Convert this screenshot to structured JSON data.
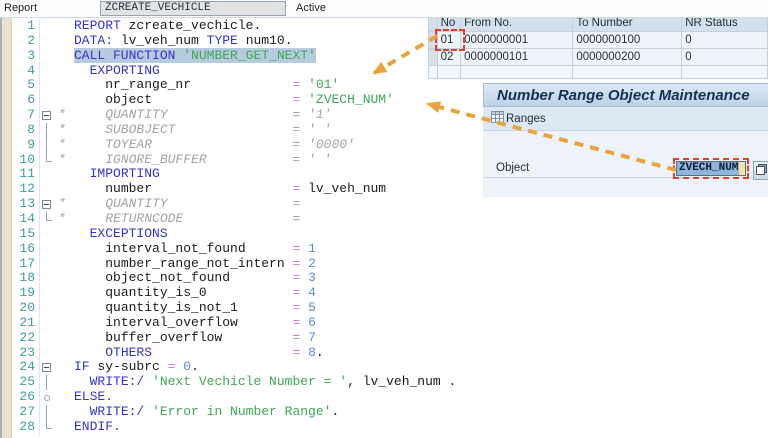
{
  "header": {
    "label": "Report",
    "program_name": "ZCREATE_VECHICLE",
    "status": "Active"
  },
  "editor": {
    "lines": [
      {
        "n": 1,
        "tokens": [
          [
            "kw",
            "REPORT"
          ],
          [
            "pl",
            " "
          ],
          [
            "id",
            "zcreate_vechicle"
          ],
          [
            "pl",
            "."
          ]
        ]
      },
      {
        "n": 2,
        "tokens": [
          [
            "kw",
            "DATA:"
          ],
          [
            "pl",
            " "
          ],
          [
            "id",
            "lv_veh_num"
          ],
          [
            "pl",
            " "
          ],
          [
            "kw",
            "TYPE"
          ],
          [
            "pl",
            " "
          ],
          [
            "id",
            "num10"
          ],
          [
            "pl",
            "."
          ]
        ]
      },
      {
        "n": 3,
        "hl": true,
        "tokens": [
          [
            "kw",
            "CALL FUNCTION"
          ],
          [
            "pl",
            " "
          ],
          [
            "lit",
            "'NUMBER_GET_NEXT'"
          ]
        ]
      },
      {
        "n": 4,
        "tokens": [
          [
            "pl",
            "  "
          ],
          [
            "kw",
            "EXPORTING"
          ]
        ]
      },
      {
        "n": 5,
        "tokens": [
          [
            "pl",
            "    "
          ],
          [
            "id",
            "nr_range_nr"
          ],
          [
            "pl",
            "             "
          ],
          [
            "op",
            "="
          ],
          [
            "pl",
            " "
          ],
          [
            "lit",
            "'01'"
          ]
        ]
      },
      {
        "n": 6,
        "tokens": [
          [
            "pl",
            "    "
          ],
          [
            "id",
            "object"
          ],
          [
            "pl",
            "                  "
          ],
          [
            "op",
            "="
          ],
          [
            "pl",
            " "
          ],
          [
            "lit",
            "'ZVECH_NUM'"
          ]
        ]
      },
      {
        "n": 7,
        "fold": "open",
        "star": "*",
        "tokens": [
          [
            "com",
            "    QUANTITY                = '1'"
          ]
        ]
      },
      {
        "n": 8,
        "fold": "pipe",
        "star": "*",
        "tokens": [
          [
            "com",
            "    SUBOBJECT               = ' '"
          ]
        ]
      },
      {
        "n": 9,
        "fold": "pipe",
        "star": "*",
        "tokens": [
          [
            "com",
            "    TOYEAR                  = '0000'"
          ]
        ]
      },
      {
        "n": 10,
        "fold": "end",
        "star": "*",
        "tokens": [
          [
            "com",
            "    IGNORE_BUFFER           = ' '"
          ]
        ]
      },
      {
        "n": 11,
        "tokens": [
          [
            "pl",
            "  "
          ],
          [
            "kw",
            "IMPORTING"
          ]
        ]
      },
      {
        "n": 12,
        "tokens": [
          [
            "pl",
            "    "
          ],
          [
            "id",
            "number"
          ],
          [
            "pl",
            "                  "
          ],
          [
            "op",
            "="
          ],
          [
            "pl",
            " "
          ],
          [
            "id",
            "lv_veh_num"
          ]
        ]
      },
      {
        "n": 13,
        "fold": "open",
        "star": "*",
        "tokens": [
          [
            "com",
            "    QUANTITY                ="
          ]
        ]
      },
      {
        "n": 14,
        "fold": "end",
        "star": "*",
        "tokens": [
          [
            "com",
            "    RETURNCODE              ="
          ]
        ]
      },
      {
        "n": 15,
        "tokens": [
          [
            "pl",
            "  "
          ],
          [
            "kw",
            "EXCEPTIONS"
          ]
        ]
      },
      {
        "n": 16,
        "tokens": [
          [
            "pl",
            "    "
          ],
          [
            "id",
            "interval_not_found"
          ],
          [
            "pl",
            "      "
          ],
          [
            "op",
            "="
          ],
          [
            "pl",
            " "
          ],
          [
            "num",
            "1"
          ]
        ]
      },
      {
        "n": 17,
        "tokens": [
          [
            "pl",
            "    "
          ],
          [
            "id",
            "number_range_not_intern"
          ],
          [
            "pl",
            " "
          ],
          [
            "op",
            "="
          ],
          [
            "pl",
            " "
          ],
          [
            "num",
            "2"
          ]
        ]
      },
      {
        "n": 18,
        "tokens": [
          [
            "pl",
            "    "
          ],
          [
            "id",
            "object_not_found"
          ],
          [
            "pl",
            "        "
          ],
          [
            "op",
            "="
          ],
          [
            "pl",
            " "
          ],
          [
            "num",
            "3"
          ]
        ]
      },
      {
        "n": 19,
        "tokens": [
          [
            "pl",
            "    "
          ],
          [
            "id",
            "quantity_is_0"
          ],
          [
            "pl",
            "           "
          ],
          [
            "op",
            "="
          ],
          [
            "pl",
            " "
          ],
          [
            "num",
            "4"
          ]
        ]
      },
      {
        "n": 20,
        "tokens": [
          [
            "pl",
            "    "
          ],
          [
            "id",
            "quantity_is_not_1"
          ],
          [
            "pl",
            "       "
          ],
          [
            "op",
            "="
          ],
          [
            "pl",
            " "
          ],
          [
            "num",
            "5"
          ]
        ]
      },
      {
        "n": 21,
        "tokens": [
          [
            "pl",
            "    "
          ],
          [
            "id",
            "interval_overflow"
          ],
          [
            "pl",
            "       "
          ],
          [
            "op",
            "="
          ],
          [
            "pl",
            " "
          ],
          [
            "num",
            "6"
          ]
        ]
      },
      {
        "n": 22,
        "tokens": [
          [
            "pl",
            "    "
          ],
          [
            "id",
            "buffer_overflow"
          ],
          [
            "pl",
            "         "
          ],
          [
            "op",
            "="
          ],
          [
            "pl",
            " "
          ],
          [
            "num",
            "7"
          ]
        ]
      },
      {
        "n": 23,
        "tokens": [
          [
            "pl",
            "    "
          ],
          [
            "kw",
            "OTHERS"
          ],
          [
            "pl",
            "                  "
          ],
          [
            "op",
            "="
          ],
          [
            "pl",
            " "
          ],
          [
            "num",
            "8"
          ],
          [
            "pl",
            "."
          ]
        ]
      },
      {
        "n": 24,
        "fold": "open",
        "tokens": [
          [
            "kw",
            "IF"
          ],
          [
            "pl",
            " "
          ],
          [
            "id",
            "sy-subrc"
          ],
          [
            "pl",
            " "
          ],
          [
            "op",
            "="
          ],
          [
            "pl",
            " "
          ],
          [
            "num",
            "0"
          ],
          [
            "pl",
            "."
          ]
        ]
      },
      {
        "n": 25,
        "fold": "pipe",
        "tokens": [
          [
            "pl",
            "  "
          ],
          [
            "kw",
            "WRITE:/"
          ],
          [
            "pl",
            " "
          ],
          [
            "lit",
            "'Next Vechicle Number = '"
          ],
          [
            "pl",
            ", "
          ],
          [
            "id",
            "lv_veh_num"
          ],
          [
            "pl",
            " ."
          ]
        ]
      },
      {
        "n": 26,
        "fold": "dot",
        "tokens": [
          [
            "kw",
            "ELSE."
          ]
        ]
      },
      {
        "n": 27,
        "fold": "pipe",
        "tokens": [
          [
            "pl",
            "  "
          ],
          [
            "kw",
            "WRITE:/"
          ],
          [
            "pl",
            " "
          ],
          [
            "lit",
            "'Error in Number Range'"
          ],
          [
            "pl",
            "."
          ]
        ]
      },
      {
        "n": 28,
        "fold": "end",
        "tokens": [
          [
            "kw",
            "ENDIF."
          ]
        ]
      }
    ]
  },
  "range_table": {
    "columns": [
      "No",
      "From No.",
      "To Number",
      "NR Status"
    ],
    "rows": [
      {
        "no": "01",
        "from": "0000000001",
        "to": "0000000100",
        "status": "0"
      },
      {
        "no": "02",
        "from": "0000000101",
        "to": "0000000200",
        "status": "0"
      }
    ]
  },
  "nro_panel": {
    "title": "Number Range Object Maintenance",
    "ranges_button": "Ranges",
    "object_label": "Object",
    "object_value": "ZVECH_NUM"
  },
  "colors": {
    "arrow": "#e8a33b",
    "marker_red": "#e2402f",
    "keyword": "#3333cc",
    "literal": "#3fa757",
    "comment": "#a3a3a3",
    "operator": "#c77fc7",
    "number_token": "#5b8dd6",
    "line_number": "#3d9d9d",
    "selection_highlight": "#b7cbde",
    "input_selection": "#8fb4d9",
    "input_fill": "#f2e3a0"
  }
}
